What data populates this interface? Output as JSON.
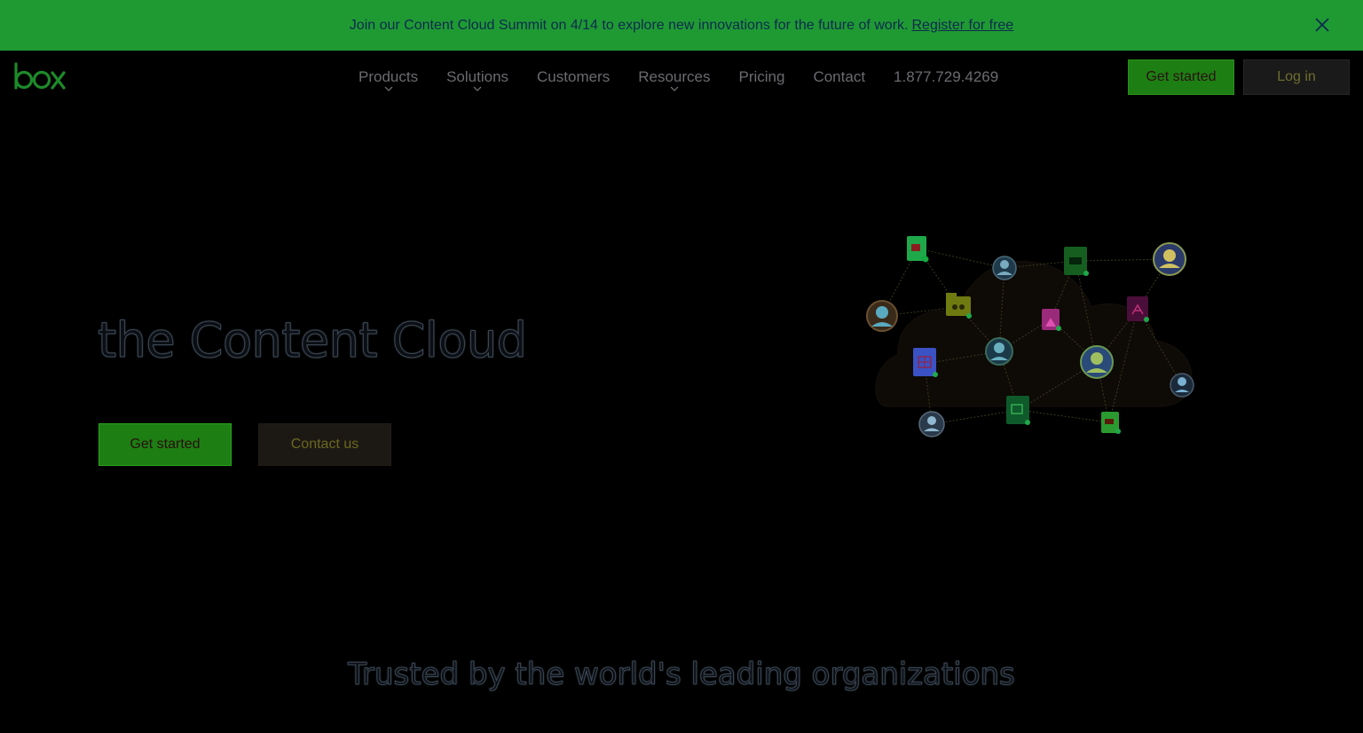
{
  "banner": {
    "message": "Join our Content Cloud Summit on 4/14 to explore new innovations for the future of work.",
    "link_label": "Register for free",
    "close_icon": "close-icon",
    "background": "#1f9a33"
  },
  "header": {
    "logo_text": "box",
    "nav": [
      {
        "label": "Products",
        "has_dropdown": true
      },
      {
        "label": "Solutions",
        "has_dropdown": true
      },
      {
        "label": "Customers",
        "has_dropdown": false
      },
      {
        "label": "Resources",
        "has_dropdown": true
      },
      {
        "label": "Pricing",
        "has_dropdown": false
      },
      {
        "label": "Contact",
        "has_dropdown": false
      },
      {
        "label": "1.877.729.4269",
        "has_dropdown": false
      }
    ],
    "get_started_label": "Get started",
    "login_label": "Log in"
  },
  "hero": {
    "title": "the Content Cloud",
    "get_started_label": "Get started",
    "contact_label": "Contact us"
  },
  "trusted": {
    "heading": "Trusted by the world's leading organizations"
  },
  "colors": {
    "brand_green": "#1d7e14",
    "background": "#000000"
  }
}
